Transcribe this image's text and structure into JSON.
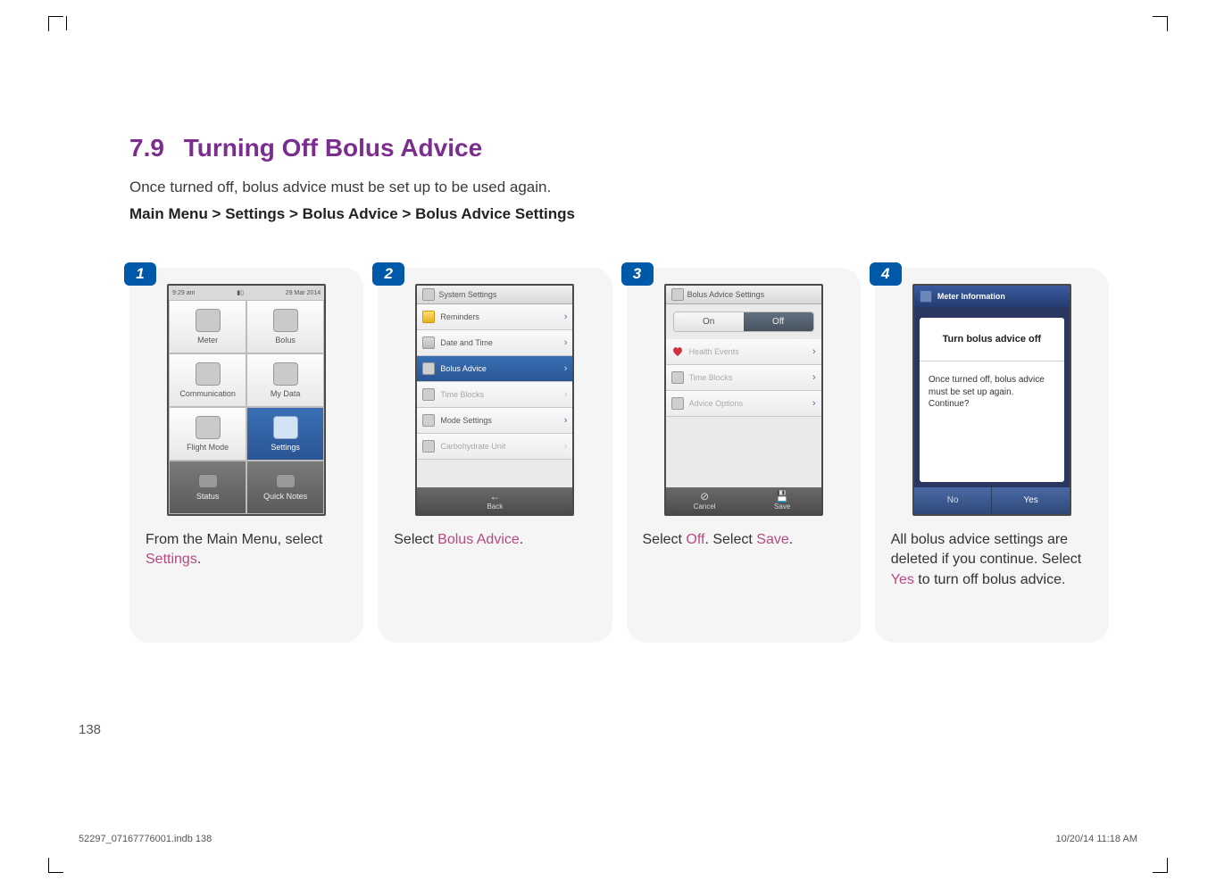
{
  "section": {
    "number": "7.9",
    "title": "Turning Off Bolus Advice"
  },
  "intro": "Once turned off, bolus advice must be set up to be used again.",
  "breadcrumb": "Main Menu > Settings > Bolus Advice > Bolus Advice Settings",
  "page_number": "138",
  "footer_left": "52297_07167776001.indb   138",
  "footer_right": "10/20/14   11:18 AM",
  "steps": [
    {
      "num": "1",
      "statusbar": {
        "time": "9:29 am",
        "date": "29 Mar 2014"
      },
      "menu": [
        {
          "label": "Meter"
        },
        {
          "label": "Bolus"
        },
        {
          "label": "Communication"
        },
        {
          "label": "My Data"
        },
        {
          "label": "Flight Mode"
        },
        {
          "label": "Settings",
          "hl": true
        },
        {
          "label": "Status",
          "dark": true
        },
        {
          "label": "Quick Notes",
          "dark": true
        }
      ],
      "caption_pre": "From the Main Menu, select ",
      "caption_hl": "Settings",
      "caption_post": "."
    },
    {
      "num": "2",
      "header": "System Settings",
      "rows": [
        {
          "label": "Reminders",
          "icon": "bell"
        },
        {
          "label": "Date and Time",
          "icon": "clock"
        },
        {
          "label": "Bolus Advice",
          "sel": true,
          "icon": "bolus"
        },
        {
          "label": "Time Blocks",
          "dis": true,
          "icon": "blocks"
        },
        {
          "label": "Mode Settings",
          "icon": "mode"
        },
        {
          "label": "Carbohydrate Unit",
          "dis": true,
          "icon": "carb"
        }
      ],
      "footer_btn": "Back",
      "caption_pre": "Select ",
      "caption_hl": "Bolus Advice",
      "caption_post": "."
    },
    {
      "num": "3",
      "header": "Bolus Advice Settings",
      "seg": {
        "on": "On",
        "off": "Off"
      },
      "rows": [
        {
          "label": "Health Events",
          "icon": "heart"
        },
        {
          "label": "Time Blocks",
          "icon": "blocks"
        },
        {
          "label": "Advice Options",
          "icon": "advice"
        }
      ],
      "footer": {
        "cancel": "Cancel",
        "save": "Save"
      },
      "caption_pre": "Select ",
      "caption_hl": "Off",
      "caption_mid": ". Select ",
      "caption_hl2": "Save",
      "caption_post": "."
    },
    {
      "num": "4",
      "title": "Meter Information",
      "heading": "Turn bolus advice off",
      "message": "Once turned off, bolus advice must be set up again. Continue?",
      "no": "No",
      "yes": "Yes",
      "caption_pre": "All bolus advice settings are deleted if you continue. Select ",
      "caption_hl": "Yes",
      "caption_post": " to turn off bolus advice."
    }
  ]
}
